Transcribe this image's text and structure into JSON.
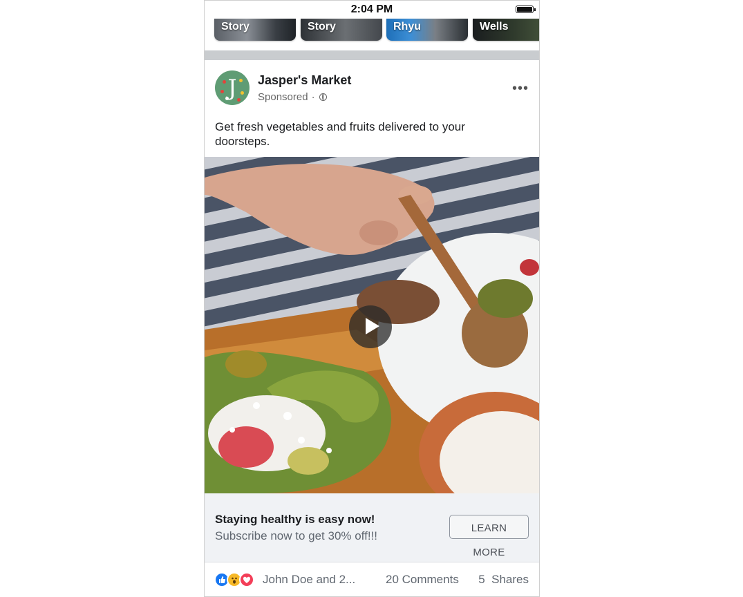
{
  "status_bar": {
    "time": "2:04 PM"
  },
  "stories": [
    {
      "label": "Story"
    },
    {
      "label": "Story"
    },
    {
      "label": "Rhyu"
    },
    {
      "label": "Wells"
    }
  ],
  "post": {
    "page_name": "Jasper's Market",
    "sponsored_label": "Sponsored",
    "separator": "·",
    "text": "Get fresh vegetables and fruits delivered to your doorsteps."
  },
  "cta": {
    "headline": "Staying healthy is easy now!",
    "subtext": "Subscribe now to get 30% off!!!",
    "button_label": "LEARN MORE"
  },
  "footer": {
    "reactors": "John Doe and 2...",
    "comments": "20 Comments",
    "shares": "5  Shares"
  },
  "colors": {
    "like": "#1877f2",
    "wow": "#f7b928",
    "love": "#f33e58",
    "avatar": "#5f9c74"
  }
}
